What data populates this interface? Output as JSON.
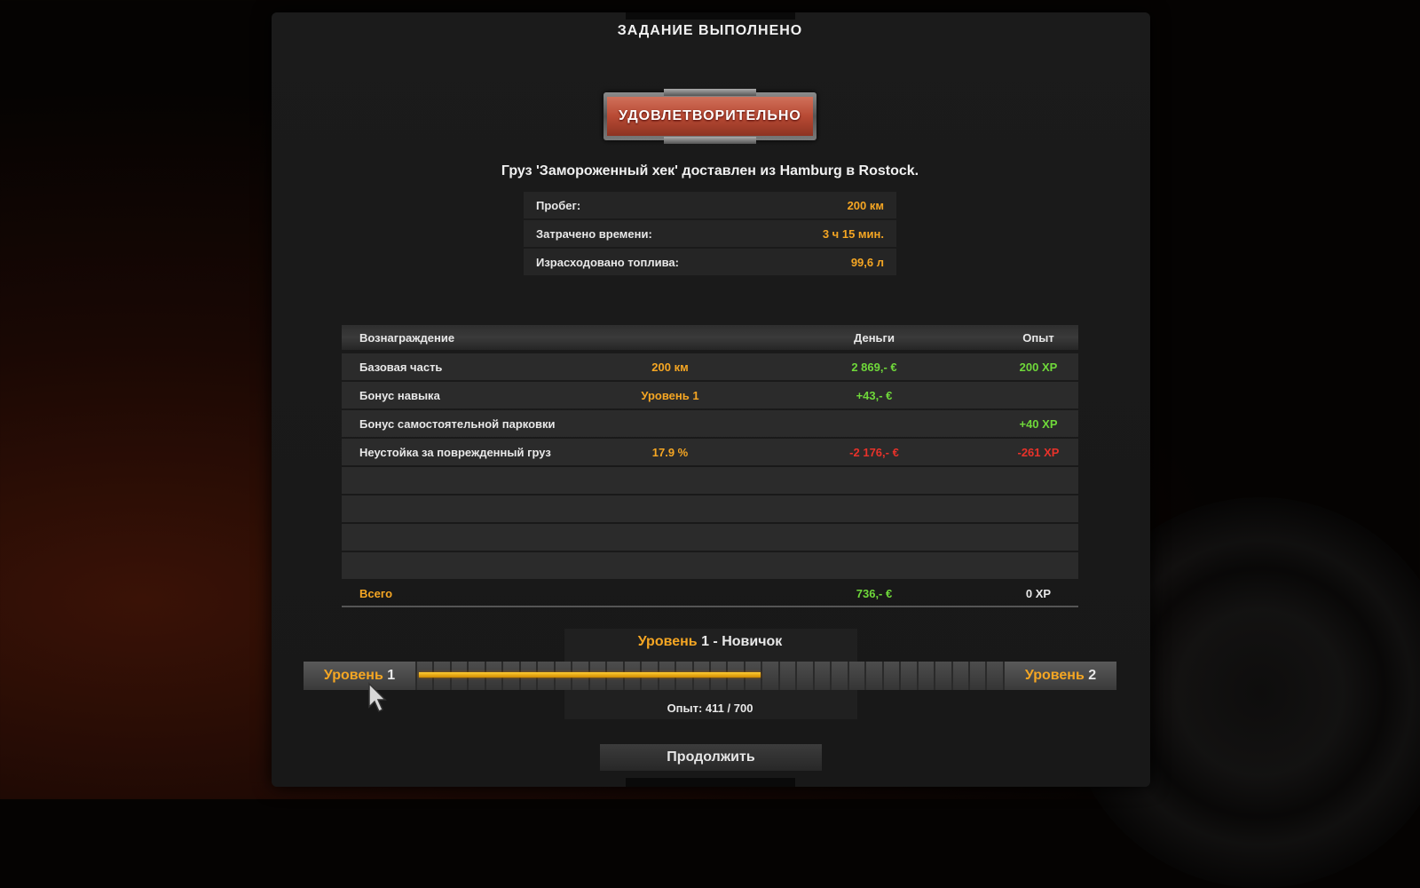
{
  "header": {
    "title": "ЗАДАНИЕ ВЫПОЛНЕНО"
  },
  "rating": {
    "label": "УДОВЛЕТВОРИТЕЛЬНО",
    "color": "#b84a34"
  },
  "cargo_line": "Груз 'Замороженный хек' доставлен из Hamburg в Rostock.",
  "stats": [
    {
      "label": "Пробег:",
      "value": "200 км"
    },
    {
      "label": "Затрачено времени:",
      "value": "3 ч 15 мин."
    },
    {
      "label": "Израсходовано топлива:",
      "value": "99,6 л"
    }
  ],
  "rewards": {
    "headers": {
      "reward": "Вознаграждение",
      "money": "Деньги",
      "xp": "Опыт"
    },
    "rows": [
      {
        "name": "Базовая часть",
        "detail": "200 км",
        "money": "2 869,- €",
        "xp": "200 XP"
      },
      {
        "name": "Бонус навыка",
        "detail": "Уровень 1",
        "money": "+43,- €",
        "xp": ""
      },
      {
        "name": "Бонус самостоятельной парковки",
        "detail": "",
        "money": "",
        "xp": "+40 XP"
      },
      {
        "name": "Неустойка за поврежденный груз",
        "detail": "17.9 %",
        "money": "-2 176,- €",
        "xp": "-261 XP"
      }
    ],
    "total": {
      "label": "Всего",
      "money": "736,- €",
      "xp": "0 XP"
    }
  },
  "level": {
    "title_word": "Уровень",
    "title_num": "1",
    "title_rank": " - Новичок",
    "left_word": "Уровень",
    "left_num": "1",
    "right_word": "Уровень",
    "right_num": "2",
    "progress": 0.587,
    "xp_text": "Опыт: 411 / 700"
  },
  "continue_label": "Продолжить",
  "colors": {
    "accent": "#f5a623",
    "positive": "#6fd83a",
    "negative": "#e8322a"
  }
}
